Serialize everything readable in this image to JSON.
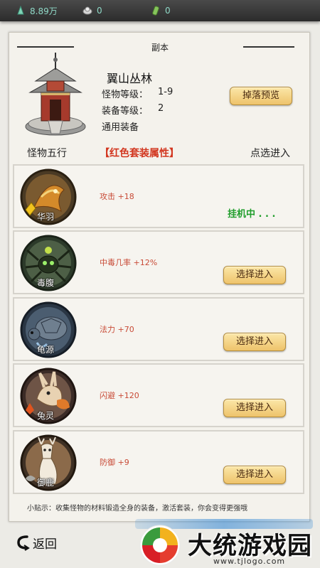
{
  "resources": [
    {
      "icon": "jade-icon",
      "value": "8.89万"
    },
    {
      "icon": "silver-ingot-icon",
      "value": "0"
    },
    {
      "icon": "green-gem-icon",
      "value": "0"
    }
  ],
  "header": {
    "title": "副本"
  },
  "dungeon": {
    "name": "翼山丛林",
    "monster_level_label": "怪物等级：",
    "monster_level_value": "1-9",
    "equip_level_label": "装备等级：",
    "equip_level_value": "2",
    "equip_type": "通用装备",
    "drop_preview_button": "掉落预览"
  },
  "sections": {
    "elements_label": "怪物五行",
    "set_attr_label": "【红色套装属性】",
    "select_label": "点选进入"
  },
  "monsters": [
    {
      "name": "华羽",
      "attr": "攻击 +18",
      "status": "挂机中 . . ."
    },
    {
      "name": "毒腹",
      "attr": "中毒几率 +12%",
      "button": "选择进入"
    },
    {
      "name": "龟源",
      "attr": "法力 +70",
      "button": "选择进入"
    },
    {
      "name": "兔灵",
      "attr": "闪避 +120",
      "button": "选择进入"
    },
    {
      "name": "御鹿",
      "attr": "防御 +9",
      "button": "选择进入"
    }
  ],
  "tip": "小贴示：收集怪物的材料锻造全身的装备，激活套装，你会变得更强哦",
  "back_label": "返回",
  "watermark": {
    "brand": "大统游戏园",
    "url": "www.tjlogo.com"
  },
  "colors": {
    "accent_red": "#d2361f",
    "status_green": "#1f9d2b",
    "button_gold": "#eec36b"
  }
}
